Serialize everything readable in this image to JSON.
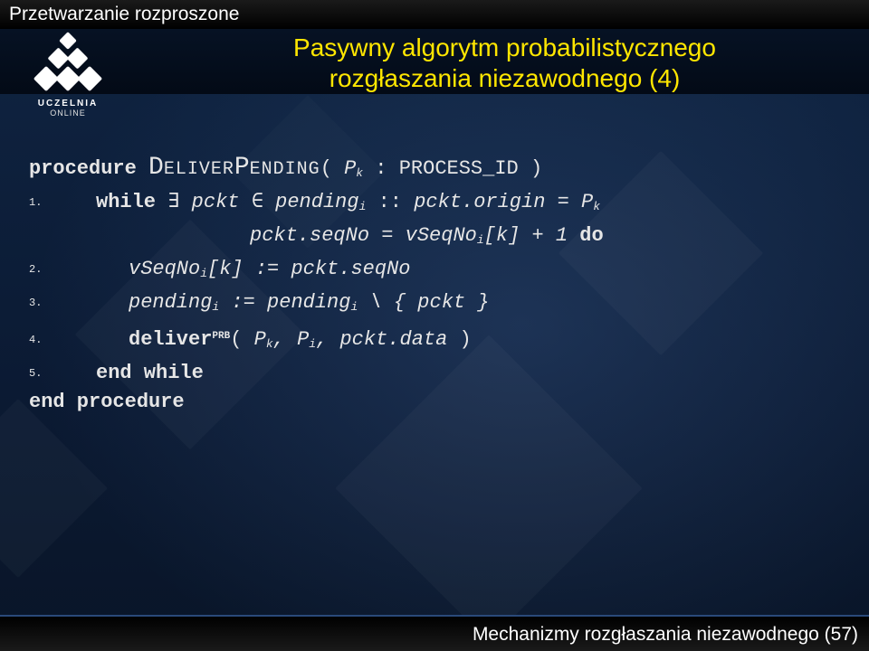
{
  "header": "Przetwarzanie rozproszone",
  "title_l1": "Pasywny algorytm probabilistycznego",
  "title_l2": "rozgłaszania niezawodnego (4)",
  "logo": {
    "line1": "UCZELNIA",
    "line2": "ONLINE"
  },
  "code": {
    "proc_kw": "procedure",
    "proc_name_D": "D",
    "proc_name_eliver": "ELIVER",
    "proc_name_P": "P",
    "proc_name_ending": "ENDING",
    "proc_args_open": "( ",
    "proc_arg_P": "P",
    "proc_arg_k": "k",
    "proc_arg_sep": " : ",
    "proc_arg_type": "PROCESS_ID",
    "proc_args_close": " )",
    "n1": "1.",
    "n2": "2.",
    "n3": "3.",
    "n4": "4.",
    "n5": "5.",
    "while": "while",
    "exists": "∃",
    "pckt": "pckt",
    "elem": "∈",
    "pending": "pending",
    "sub_i": "i",
    "colcol": " :: ",
    "pckt_origin": "pckt.origin",
    "eq": " = ",
    "Pk_P": "P",
    "Pk_k": "k",
    "pckt_seqNo": "pckt.seqNo",
    "vSeqNo": "vSeqNo",
    "brk_k": "[k]",
    "plus1": " + 1 ",
    "do": "do",
    "assign": " := ",
    "setminus": " \\ { ",
    "setclose": " }",
    "deliver": "deliver",
    "prb": "PRB",
    "open": "( ",
    "comma": ", ",
    "Pi_P": "P",
    "Pi_i": "i",
    "pckt_data": "pckt.data",
    "close": " )",
    "endwhile": "end while",
    "endproc": "end procedure"
  },
  "footer": "Mechanizmy rozgłaszania niezawodnego (57)"
}
